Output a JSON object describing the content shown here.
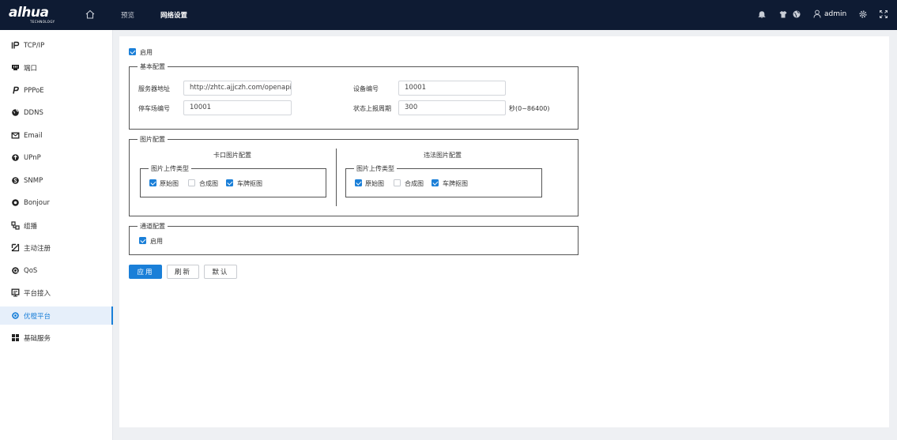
{
  "topbar": {
    "logo_text": "alhua",
    "logo_sub": "TECHNOLOGY",
    "nav": [
      {
        "label": "预览"
      },
      {
        "label": "网络设置"
      }
    ],
    "user_name": "admin"
  },
  "sidebar": {
    "items": [
      {
        "label": "TCP/IP",
        "icon": "ip-icon"
      },
      {
        "label": "端口",
        "icon": "port-icon"
      },
      {
        "label": "PPPoE",
        "icon": "pppoe-icon"
      },
      {
        "label": "DDNS",
        "icon": "ddns-icon"
      },
      {
        "label": "Email",
        "icon": "email-icon"
      },
      {
        "label": "UPnP",
        "icon": "upnp-icon"
      },
      {
        "label": "SNMP",
        "icon": "snmp-icon"
      },
      {
        "label": "Bonjour",
        "icon": "bonjour-icon"
      },
      {
        "label": "组播",
        "icon": "multicast-icon"
      },
      {
        "label": "主动注册",
        "icon": "register-icon"
      },
      {
        "label": "QoS",
        "icon": "qos-icon"
      },
      {
        "label": "平台接入",
        "icon": "platform-icon"
      },
      {
        "label": "优橙平台",
        "icon": "youcheng-icon"
      },
      {
        "label": "基础服务",
        "icon": "service-icon"
      }
    ],
    "active_index": 12
  },
  "main": {
    "enable": {
      "label": "启用",
      "checked": true
    },
    "basic": {
      "legend": "基本配置",
      "server_label": "服务器地址",
      "server_value": "http://zhtc.ajjczh.com/openapi",
      "device_label": "设备编号",
      "device_value": "10001",
      "parking_label": "停车场编号",
      "parking_value": "10001",
      "report_label": "状态上报周期",
      "report_value": "300",
      "report_unit": "秒(0~86400)"
    },
    "picture": {
      "legend": "图片配置",
      "left_title": "卡口图片配置",
      "right_title": "违法图片配置",
      "type_legend": "图片上传类型",
      "options": [
        "原始图",
        "合成图",
        "车牌抠图"
      ],
      "left_checked": [
        true,
        false,
        true
      ],
      "right_checked": [
        true,
        false,
        true
      ]
    },
    "channel": {
      "legend": "通道配置",
      "enable_label": "启用",
      "checked": true
    },
    "buttons": {
      "apply": "应用",
      "refresh": "刷新",
      "default": "默认"
    }
  },
  "colors": {
    "topbar": "#0e1b33",
    "accent": "#1a7fd8",
    "page_bg": "#eef0f3"
  }
}
